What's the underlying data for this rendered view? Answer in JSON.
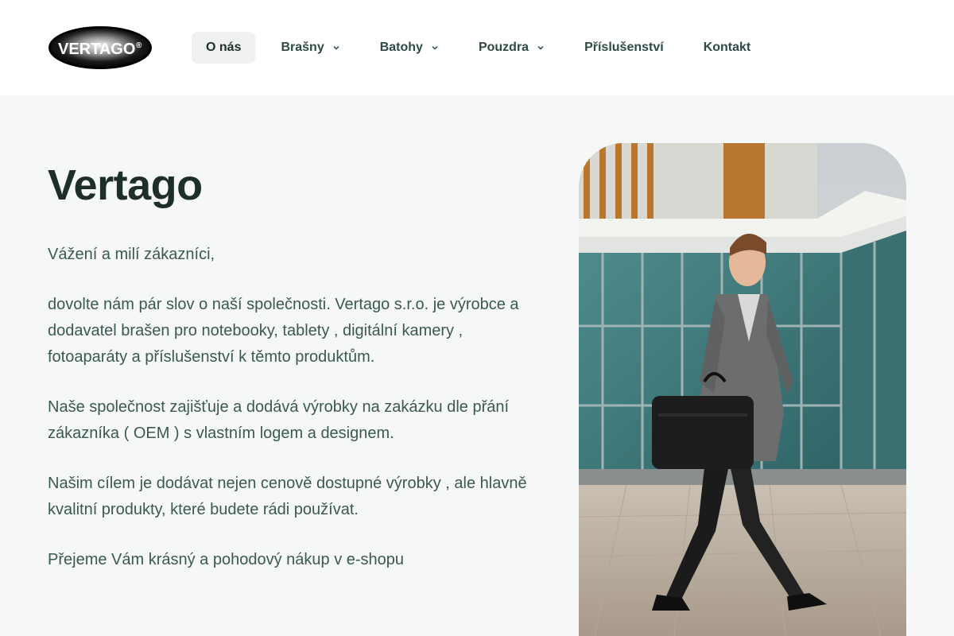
{
  "header": {
    "logo_text": "VERTAGO",
    "logo_mark": "®",
    "nav": [
      {
        "label": "O nás",
        "active": true,
        "dropdown": false
      },
      {
        "label": "Brašny",
        "active": false,
        "dropdown": true
      },
      {
        "label": "Batohy",
        "active": false,
        "dropdown": true
      },
      {
        "label": "Pouzdra",
        "active": false,
        "dropdown": true
      },
      {
        "label": "Příslušenství",
        "active": false,
        "dropdown": false
      },
      {
        "label": "Kontakt",
        "active": false,
        "dropdown": false
      }
    ]
  },
  "main": {
    "title": "Vertago",
    "paragraphs": [
      "Vážení a milí zákazníci,",
      "dovolte nám pár slov o naší společnosti. Vertago s.r.o. je výrobce a dodavatel brašen pro notebooky, tablety , digitální kamery , fotoaparáty a příslušenství k těmto produktům.",
      "Naše společnost zajišťuje a dodává výrobky na zakázku dle přání zákazníka ( OEM ) s vlastním logem a designem.",
      "Našim cílem je dodávat nejen cenově dostupné výrobky , ale hlavně kvalitní produkty, které budete rádi používat.",
      "Přejeme Vám krásný a pohodový nákup v e-shopu"
    ]
  },
  "colors": {
    "page_bg": "#f6f8f7",
    "header_bg": "#ffffff",
    "text": "#3b5853",
    "heading": "#1e2e2b",
    "active_nav_bg": "#eef1f0"
  }
}
